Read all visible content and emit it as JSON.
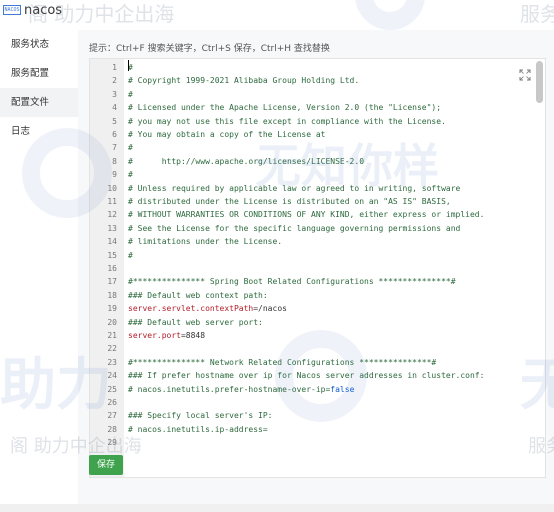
{
  "app": {
    "logo_text": "nacos",
    "logo_badge": "NACOS"
  },
  "sidebar": {
    "items": [
      {
        "label": "服务状态"
      },
      {
        "label": "服务配置"
      },
      {
        "label": "配置文件",
        "active": true
      },
      {
        "label": "日志"
      }
    ]
  },
  "main": {
    "hint": "提示：Ctrl+F 搜索关键字，Ctrl+S 保存，Ctrl+H 查找替换",
    "save_label": "保存"
  },
  "editor": {
    "lines": [
      {
        "n": "1",
        "text": "#",
        "type": "comment"
      },
      {
        "n": "2",
        "text": "# Copyright 1999-2021 Alibaba Group Holding Ltd.",
        "type": "comment"
      },
      {
        "n": "3",
        "text": "#",
        "type": "comment"
      },
      {
        "n": "4",
        "text": "# Licensed under the Apache License, Version 2.0 (the \"License\");",
        "type": "comment"
      },
      {
        "n": "5",
        "text": "# you may not use this file except in compliance with the License.",
        "type": "comment"
      },
      {
        "n": "6",
        "text": "# You may obtain a copy of the License at",
        "type": "comment"
      },
      {
        "n": "7",
        "text": "#",
        "type": "comment"
      },
      {
        "n": "8",
        "text": "#      http://www.apache.org/licenses/LICENSE-2.0",
        "type": "comment"
      },
      {
        "n": "9",
        "text": "#",
        "type": "comment"
      },
      {
        "n": "10",
        "text": "# Unless required by applicable law or agreed to in writing, software",
        "type": "comment"
      },
      {
        "n": "11",
        "text": "# distributed under the License is distributed on an \"AS IS\" BASIS,",
        "type": "comment"
      },
      {
        "n": "12",
        "text": "# WITHOUT WARRANTIES OR CONDITIONS OF ANY KIND, either express or implied.",
        "type": "comment"
      },
      {
        "n": "13",
        "text": "# See the License for the specific language governing permissions and",
        "type": "comment"
      },
      {
        "n": "14",
        "text": "# limitations under the License.",
        "type": "comment"
      },
      {
        "n": "15",
        "text": "#",
        "type": "comment"
      },
      {
        "n": "16",
        "text": "",
        "type": "plain"
      },
      {
        "n": "17",
        "text": "#*************** Spring Boot Related Configurations ***************#",
        "type": "comment"
      },
      {
        "n": "18",
        "text": "### Default web context path:",
        "type": "comment"
      },
      {
        "n": "19",
        "key": "server.servlet.contextPath",
        "val": "=/nacos",
        "type": "kv"
      },
      {
        "n": "20",
        "text": "### Default web server port:",
        "type": "comment"
      },
      {
        "n": "21",
        "key": "server.port",
        "val": "=8848",
        "type": "kv"
      },
      {
        "n": "22",
        "text": "",
        "type": "plain"
      },
      {
        "n": "23",
        "text": "#*************** Network Related Configurations ***************#",
        "type": "comment"
      },
      {
        "n": "24",
        "text": "### If prefer hostname over ip for Nacos server addresses in cluster.conf:",
        "type": "comment"
      },
      {
        "n": "25",
        "text": "# nacos.inetutils.prefer-hostname-over-ip=",
        "bool": "false",
        "type": "commentbool"
      },
      {
        "n": "26",
        "text": "",
        "type": "plain"
      },
      {
        "n": "27",
        "text": "### Specify local server's IP:",
        "type": "comment"
      },
      {
        "n": "28",
        "text": "# nacos.inetutils.ip-address=",
        "type": "comment"
      },
      {
        "n": "29",
        "text": "",
        "type": "plain"
      }
    ]
  },
  "watermarks": {
    "top_left": "阁 助力中企出海",
    "top_right": "服务",
    "big1": "无知你样",
    "big2": "助力",
    "big3": "无",
    "bottom_left": "阁 助力中企出海",
    "bottom_right": "服务"
  },
  "colors": {
    "accent_green": "#3fa34d",
    "comment": "#2d6a3d",
    "key": "#b31d28",
    "bool": "#0b5bd3"
  },
  "icons": {
    "fullscreen": "expand-icon"
  }
}
